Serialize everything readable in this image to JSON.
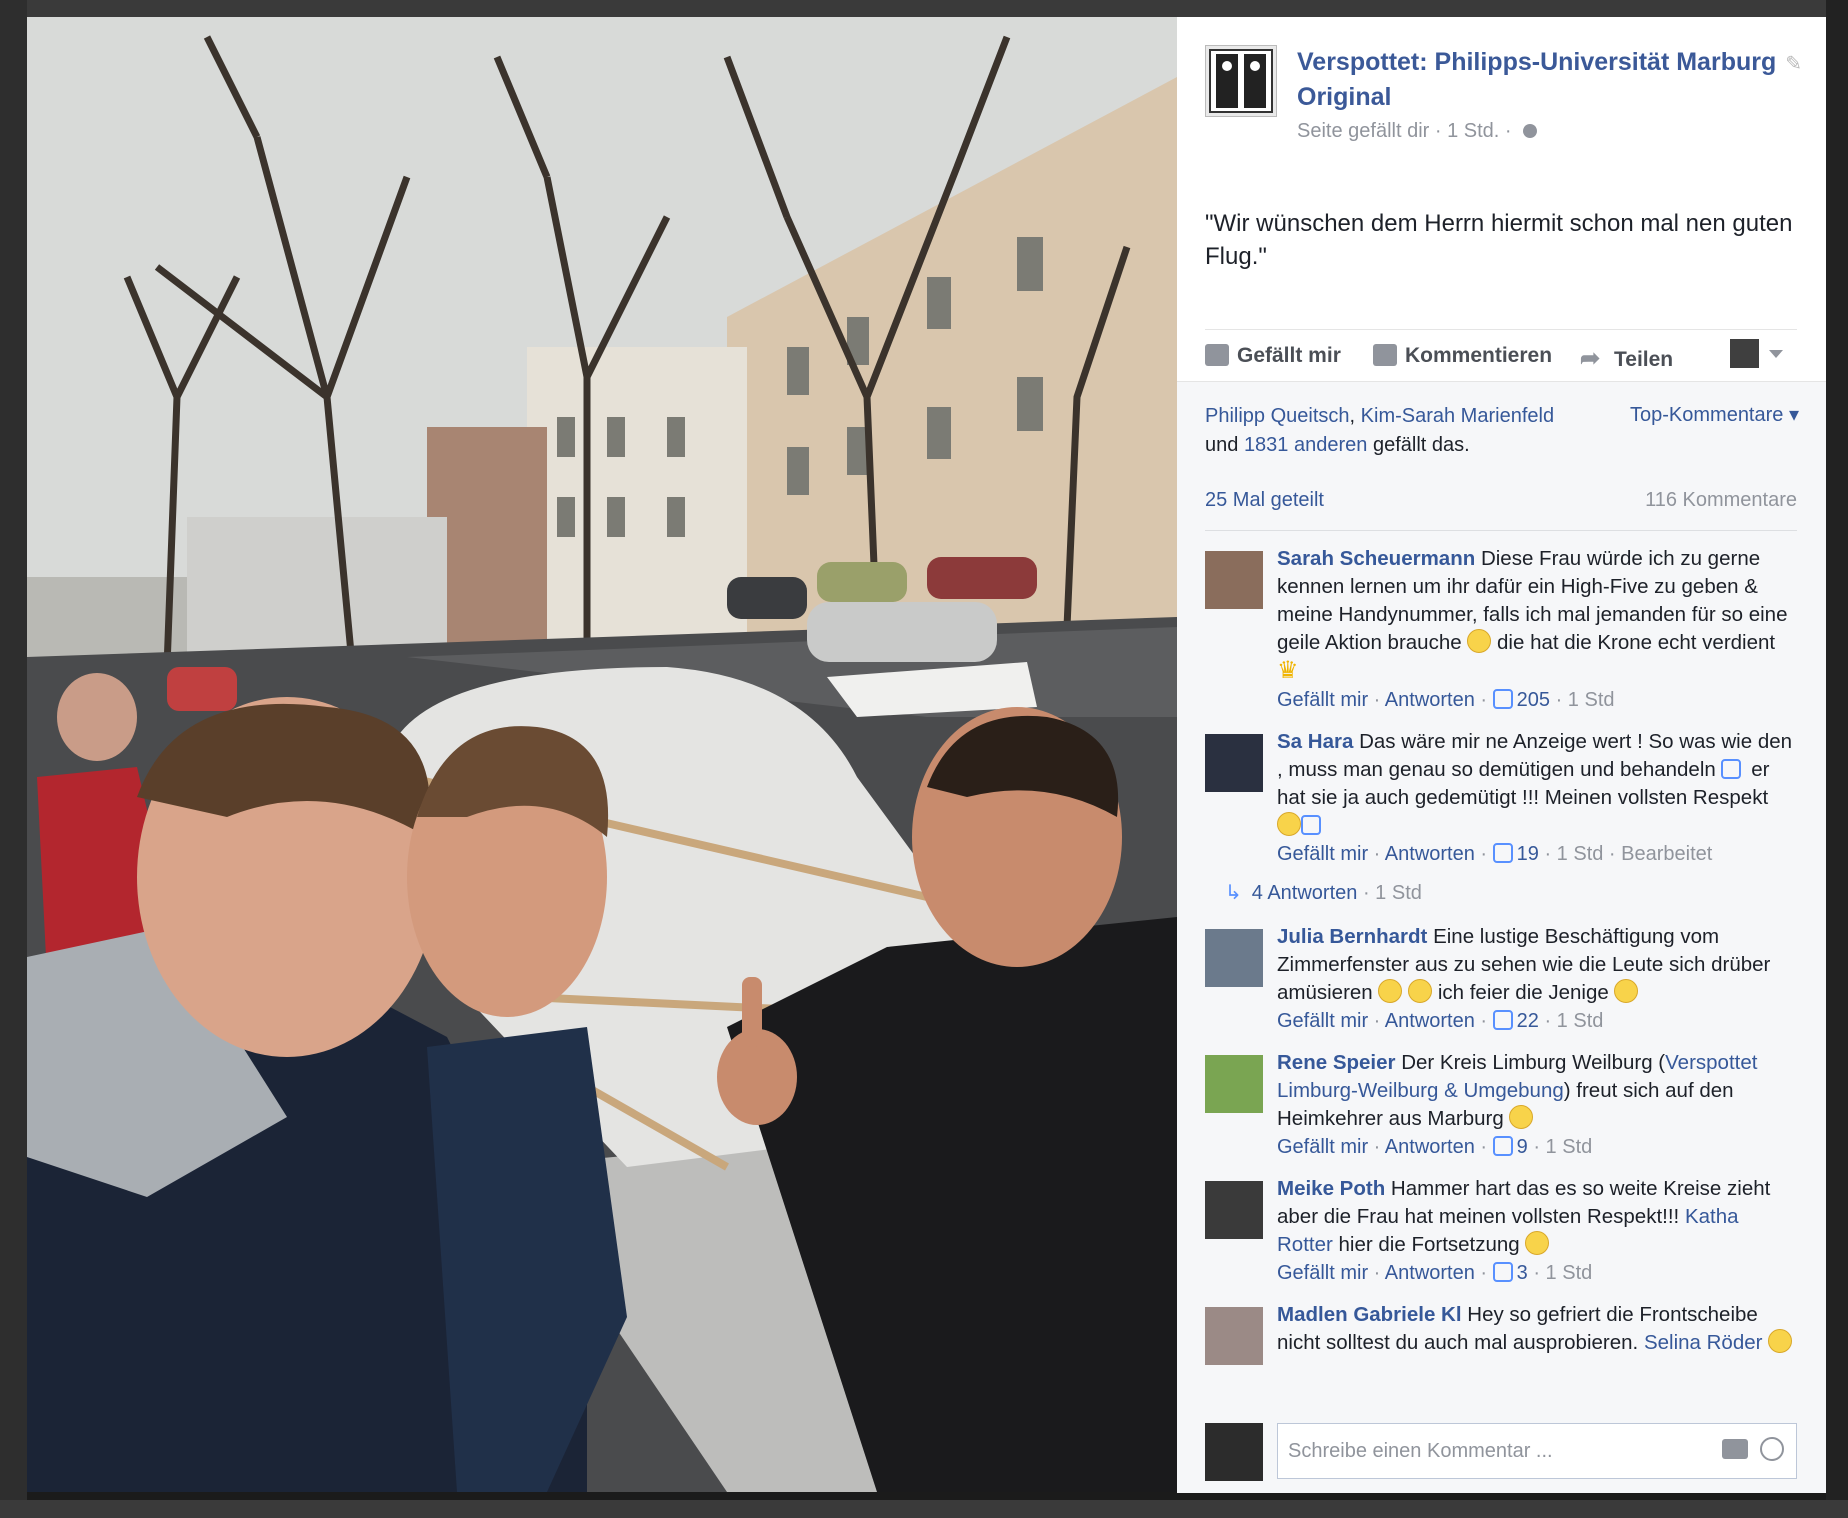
{
  "post": {
    "page_name": "Verspottet: Philipps-Universität Marburg Original",
    "meta": "Seite gefällt dir · 1 Std. ·",
    "caption": "\"Wir wünschen dem Herrn hiermit schon mal nen guten Flug.\""
  },
  "actions": {
    "like": "Gefällt mir",
    "comment": "Kommentieren",
    "share": "Teilen"
  },
  "likes": {
    "name1": "Philipp Queitsch",
    "sep": ", ",
    "name2": "Kim-Sarah Marienfeld",
    "and": "und ",
    "others": "1831 anderen",
    "suffix": " gefällt das.",
    "top_comments": "Top-Kommentare ▾"
  },
  "stats": {
    "shares": "25 Mal geteilt",
    "comments": "116 Kommentare"
  },
  "comment_meta": {
    "like": "Gefällt mir",
    "reply": "Antworten"
  },
  "comments": [
    {
      "author": "Sarah Scheuermann",
      "text_a": "Diese Frau würde ich zu gerne kennen lernen um ihr dafür ein High-Five zu geben & meine Handynummer, falls ich mal jemanden für so eine geile Aktion brauche ",
      "text_b": " die hat die Krone echt verdient ",
      "likes": "205",
      "time": "1 Std"
    },
    {
      "author": "Sa Hara",
      "text_a": "Das wäre mir ne Anzeige wert ! So was wie den , muss man genau so demütigen und behandeln ",
      "text_b": " er hat sie ja auch gedemütigt !!! Meinen vollsten Respekt ",
      "likes": "19",
      "time": "1 Std",
      "edited": "Bearbeitet",
      "replies": "4 Antworten",
      "replies_time": "1 Std"
    },
    {
      "author": "Julia Bernhardt",
      "text_a": "Eine lustige Beschäftigung vom Zimmerfenster aus zu sehen wie die Leute sich drüber amüsieren ",
      "text_b": " ich feier die Jenige ",
      "likes": "22",
      "time": "1 Std"
    },
    {
      "author": "Rene Speier",
      "text_a": "Der Kreis Limburg Weilburg (",
      "link": "Verspottet Limburg-Weilburg & Umgebung",
      "text_b": ") freut sich auf den Heimkehrer aus Marburg ",
      "likes": "9",
      "time": "1 Std"
    },
    {
      "author": "Meike Poth",
      "text_a": "Hammer hart das es so weite Kreise zieht aber die Frau hat meinen vollsten Respekt!!! ",
      "link": "Katha Rotter",
      "text_b": " hier die Fortsetzung ",
      "likes": "3",
      "time": "1 Std"
    },
    {
      "author": "Madlen Gabriele Kl",
      "text_a": "Hey so gefriert die Frontscheibe nicht solltest du auch mal ausprobieren. ",
      "link": "Selina Röder"
    }
  ],
  "write": {
    "placeholder": "Schreibe einen Kommentar ..."
  },
  "colors": {
    "link": "#365899",
    "page_name": "#3b5998",
    "meta": "#90949c"
  }
}
